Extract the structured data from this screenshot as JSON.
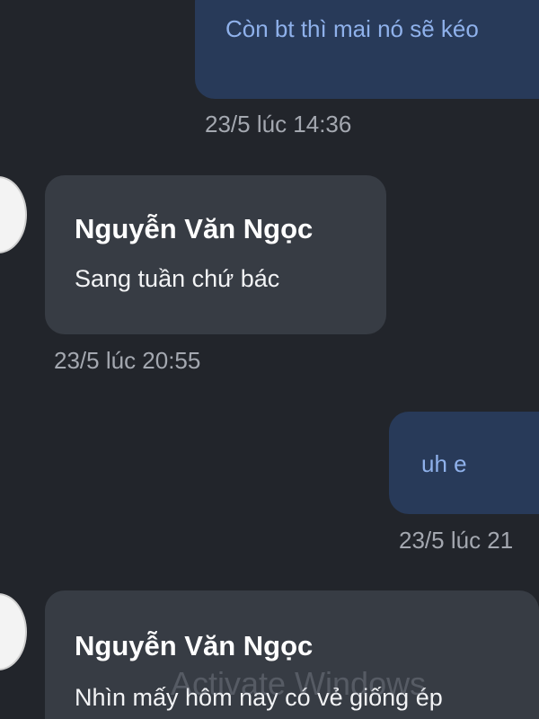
{
  "messages": [
    {
      "type": "outgoing",
      "text": "Còn bt thì mai nó sẽ kéo",
      "timestamp": "23/5 lúc 14:36"
    },
    {
      "type": "incoming",
      "sender": "Nguyễn Văn Ngọc",
      "text": "Sang tuần chứ bác",
      "timestamp": "23/5 lúc 20:55"
    },
    {
      "type": "outgoing",
      "text": "uh e",
      "timestamp": "23/5 lúc 21"
    },
    {
      "type": "incoming",
      "sender": "Nguyễn Văn Ngọc",
      "text": "Nhìn mấy hôm nay có vẻ giống ép"
    }
  ],
  "watermark": "Activate Windows",
  "colors": {
    "background": "#22252b",
    "outgoing_bubble": "#283a59",
    "outgoing_text": "#8fb1eb",
    "incoming_bubble": "#373c44",
    "timestamp": "#a4a8b0"
  }
}
